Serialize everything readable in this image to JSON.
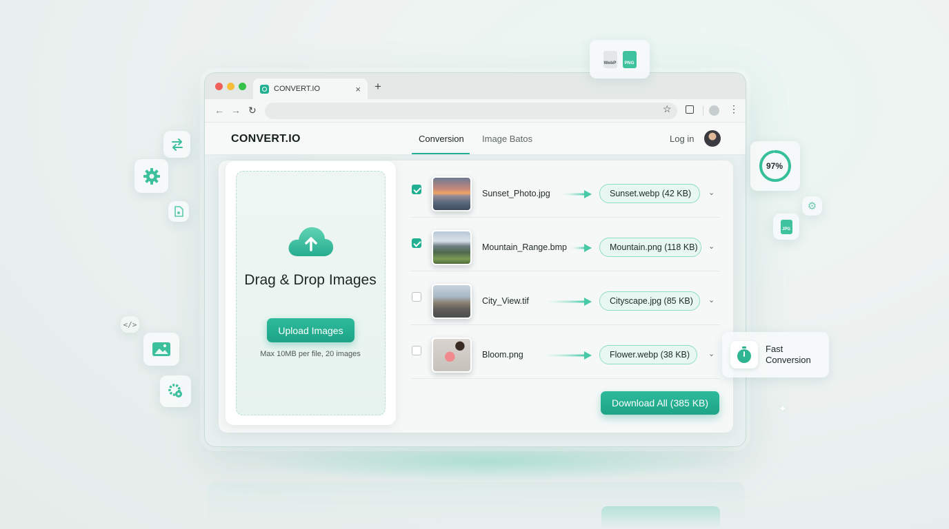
{
  "browser": {
    "tab_title": "CONVERT.IO",
    "close_glyph": "×",
    "new_tab_glyph": "+",
    "back_glyph": "←",
    "forward_glyph": "→",
    "reload_glyph": "↻",
    "star_glyph": "☆",
    "menu_glyph": "⋮"
  },
  "app": {
    "logo": "CONVERT.IO",
    "nav": [
      "Conversion",
      "Image Batos"
    ],
    "active_nav": "Conversion",
    "login": "Log in"
  },
  "dropzone": {
    "title": "Drag & Drop Images",
    "button": "Upload Images",
    "limit": "Max 10MB per file, 20 images"
  },
  "files": [
    {
      "name": "Sunset_Photo.jpg",
      "output_name": "Sunset.webp",
      "output_size": "(42 KB)",
      "checked": true,
      "thumb": "sunset"
    },
    {
      "name": "Mountain_Range.bmp",
      "output_name": "Mountain.png",
      "output_size": "(118 KB)",
      "checked": true,
      "thumb": "mountain"
    },
    {
      "name": "City_View.tif",
      "output_name": "Cityscape.jpg",
      "output_size": "(85 KB)",
      "checked": false,
      "thumb": "city"
    },
    {
      "name": "Bloom.png",
      "output_name": "Flower.webp",
      "output_size": "(38 KB)",
      "checked": false,
      "thumb": "flower"
    }
  ],
  "download_button": "Download All (385 KB)",
  "floating": {
    "file_badges": [
      "WebP",
      "PNG"
    ],
    "jpg_badge": "JPG",
    "progress_percent": 97,
    "progress_label": "97%",
    "fast_label_line1": "Fast",
    "fast_label_line2": "Conversion",
    "code_glyph": "</>"
  },
  "colors": {
    "accent": "#23b092",
    "accent_light": "#e8f7f2"
  }
}
